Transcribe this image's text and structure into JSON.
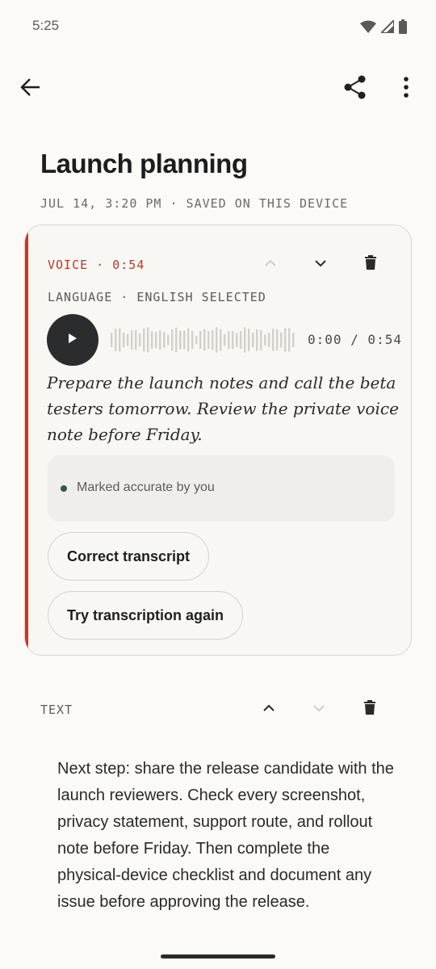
{
  "status_bar": {
    "time": "5:25",
    "icons": [
      "wifi-icon",
      "cell-signal-icon",
      "battery-icon"
    ]
  },
  "app_bar": {
    "icons": [
      "back-arrow-icon",
      "share-icon",
      "more-vert-icon"
    ]
  },
  "note": {
    "title": "Launch planning",
    "meta": "JUL 14, 3:20 PM · SAVED ON THIS DEVICE"
  },
  "voice_block": {
    "label": "VOICE · 0:54",
    "language": "LANGUAGE · ENGLISH SELECTED",
    "time_readout": "0:00 / 0:54",
    "transcript": "Prepare the launch notes and call the beta testers tomorrow. Review the private voice note before Friday.",
    "accuracy_status": "Marked accurate by you",
    "correct_button": "Correct transcript",
    "retry_button": "Try transcription again",
    "playback_progress": 0.0,
    "controls": {
      "move_up_enabled": false,
      "move_down_enabled": true
    }
  },
  "text_block": {
    "label": "TEXT",
    "body": "Next step: share the release candidate with the launch reviewers. Check every screenshot, privacy statement, support route, and rollout note before Friday. Then complete the physical-device checklist and document any issue before approving the release.",
    "controls": {
      "move_up_enabled": true,
      "move_down_enabled": false
    }
  },
  "colors": {
    "background": "#fbfaf7",
    "accent_red": "#c0392b",
    "play_button": "#2a2c2d",
    "accuracy_dot": "#2f5a45"
  }
}
